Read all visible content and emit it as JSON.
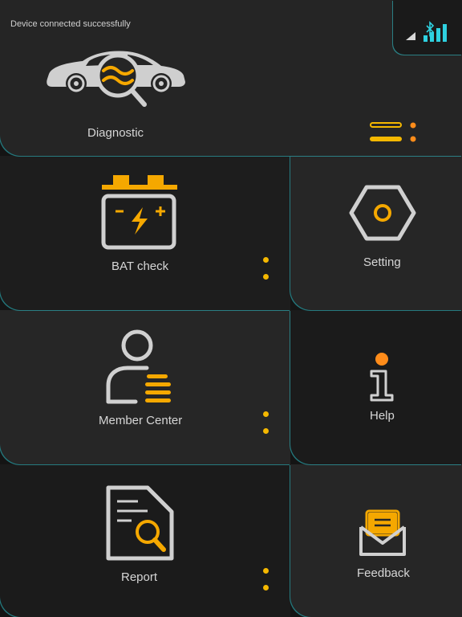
{
  "status": {
    "message": "Device connected successfully"
  },
  "tiles": {
    "diagnostic": {
      "label": "Diagnostic"
    },
    "bat_check": {
      "label": "BAT check"
    },
    "setting": {
      "label": "Setting"
    },
    "member_center": {
      "label": "Member Center"
    },
    "help": {
      "label": "Help"
    },
    "report": {
      "label": "Report"
    },
    "feedback": {
      "label": "Feedback"
    }
  },
  "colors": {
    "accent_yellow": "#f5b800",
    "accent_orange": "#ff8c1a",
    "accent_cyan": "#2ed1e0",
    "icon_gray": "#d0d0d0"
  }
}
